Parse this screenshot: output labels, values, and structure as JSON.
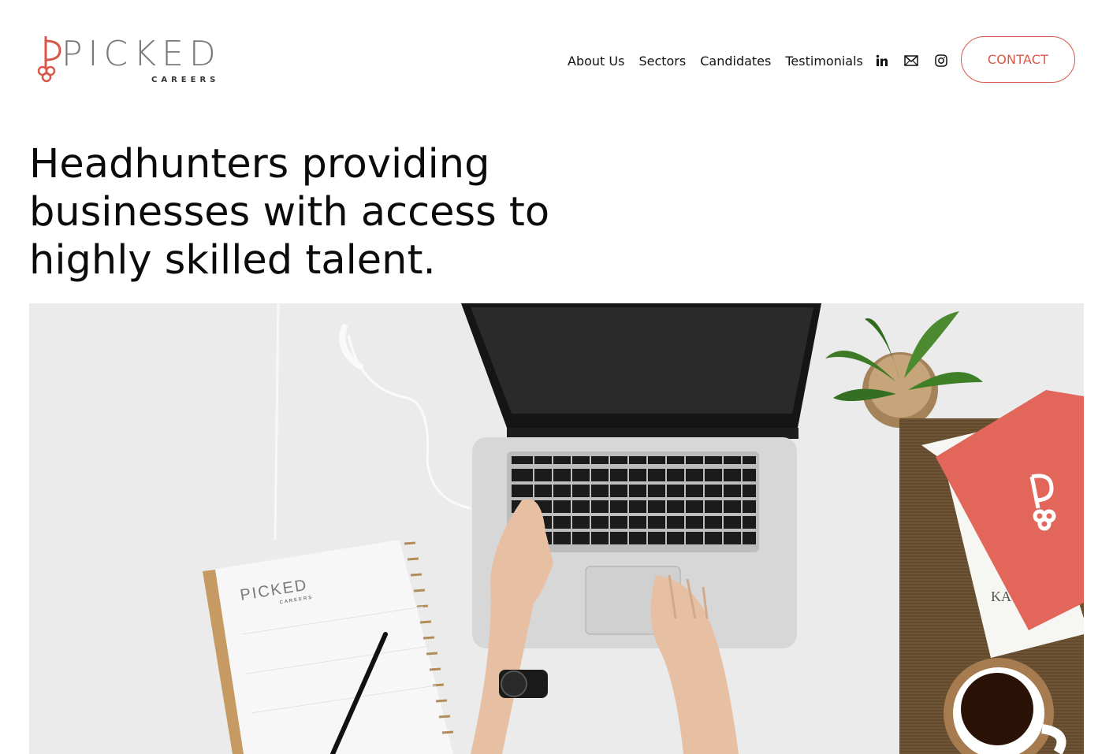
{
  "brand": {
    "name": "PICKED",
    "tagline": "CAREERS",
    "accent": "#d9574a"
  },
  "nav": {
    "items": [
      {
        "label": "About Us"
      },
      {
        "label": "Sectors"
      },
      {
        "label": "Candidates"
      },
      {
        "label": "Testimonials"
      }
    ],
    "social_icons": [
      "linkedin-icon",
      "mail-icon",
      "instagram-icon"
    ],
    "contact_label": "CONTACT"
  },
  "hero": {
    "headline": "Headhunters providing businesses with access to highly skilled talent.",
    "image_texts": {
      "notebook_brand": "PICKED",
      "notebook_tagline": "CAREERS",
      "book_letters": "KA"
    }
  }
}
